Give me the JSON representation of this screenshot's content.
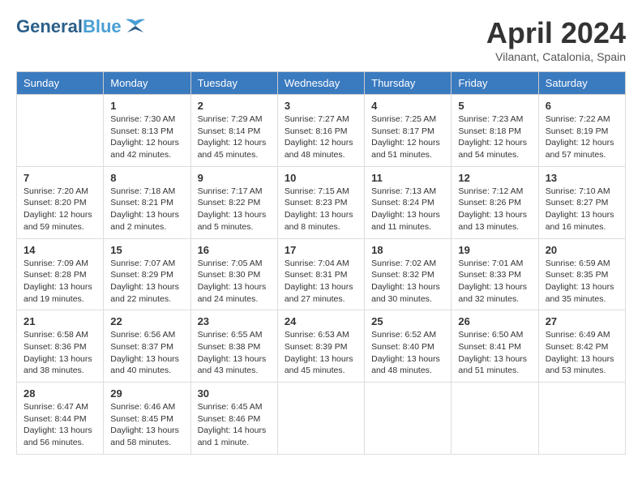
{
  "header": {
    "logo_general": "General",
    "logo_blue": "Blue",
    "month_title": "April 2024",
    "location": "Vilanant, Catalonia, Spain"
  },
  "days_of_week": [
    "Sunday",
    "Monday",
    "Tuesday",
    "Wednesday",
    "Thursday",
    "Friday",
    "Saturday"
  ],
  "weeks": [
    [
      {
        "day": "",
        "info": ""
      },
      {
        "day": "1",
        "info": "Sunrise: 7:30 AM\nSunset: 8:13 PM\nDaylight: 12 hours\nand 42 minutes."
      },
      {
        "day": "2",
        "info": "Sunrise: 7:29 AM\nSunset: 8:14 PM\nDaylight: 12 hours\nand 45 minutes."
      },
      {
        "day": "3",
        "info": "Sunrise: 7:27 AM\nSunset: 8:16 PM\nDaylight: 12 hours\nand 48 minutes."
      },
      {
        "day": "4",
        "info": "Sunrise: 7:25 AM\nSunset: 8:17 PM\nDaylight: 12 hours\nand 51 minutes."
      },
      {
        "day": "5",
        "info": "Sunrise: 7:23 AM\nSunset: 8:18 PM\nDaylight: 12 hours\nand 54 minutes."
      },
      {
        "day": "6",
        "info": "Sunrise: 7:22 AM\nSunset: 8:19 PM\nDaylight: 12 hours\nand 57 minutes."
      }
    ],
    [
      {
        "day": "7",
        "info": "Sunrise: 7:20 AM\nSunset: 8:20 PM\nDaylight: 12 hours\nand 59 minutes."
      },
      {
        "day": "8",
        "info": "Sunrise: 7:18 AM\nSunset: 8:21 PM\nDaylight: 13 hours\nand 2 minutes."
      },
      {
        "day": "9",
        "info": "Sunrise: 7:17 AM\nSunset: 8:22 PM\nDaylight: 13 hours\nand 5 minutes."
      },
      {
        "day": "10",
        "info": "Sunrise: 7:15 AM\nSunset: 8:23 PM\nDaylight: 13 hours\nand 8 minutes."
      },
      {
        "day": "11",
        "info": "Sunrise: 7:13 AM\nSunset: 8:24 PM\nDaylight: 13 hours\nand 11 minutes."
      },
      {
        "day": "12",
        "info": "Sunrise: 7:12 AM\nSunset: 8:26 PM\nDaylight: 13 hours\nand 13 minutes."
      },
      {
        "day": "13",
        "info": "Sunrise: 7:10 AM\nSunset: 8:27 PM\nDaylight: 13 hours\nand 16 minutes."
      }
    ],
    [
      {
        "day": "14",
        "info": "Sunrise: 7:09 AM\nSunset: 8:28 PM\nDaylight: 13 hours\nand 19 minutes."
      },
      {
        "day": "15",
        "info": "Sunrise: 7:07 AM\nSunset: 8:29 PM\nDaylight: 13 hours\nand 22 minutes."
      },
      {
        "day": "16",
        "info": "Sunrise: 7:05 AM\nSunset: 8:30 PM\nDaylight: 13 hours\nand 24 minutes."
      },
      {
        "day": "17",
        "info": "Sunrise: 7:04 AM\nSunset: 8:31 PM\nDaylight: 13 hours\nand 27 minutes."
      },
      {
        "day": "18",
        "info": "Sunrise: 7:02 AM\nSunset: 8:32 PM\nDaylight: 13 hours\nand 30 minutes."
      },
      {
        "day": "19",
        "info": "Sunrise: 7:01 AM\nSunset: 8:33 PM\nDaylight: 13 hours\nand 32 minutes."
      },
      {
        "day": "20",
        "info": "Sunrise: 6:59 AM\nSunset: 8:35 PM\nDaylight: 13 hours\nand 35 minutes."
      }
    ],
    [
      {
        "day": "21",
        "info": "Sunrise: 6:58 AM\nSunset: 8:36 PM\nDaylight: 13 hours\nand 38 minutes."
      },
      {
        "day": "22",
        "info": "Sunrise: 6:56 AM\nSunset: 8:37 PM\nDaylight: 13 hours\nand 40 minutes."
      },
      {
        "day": "23",
        "info": "Sunrise: 6:55 AM\nSunset: 8:38 PM\nDaylight: 13 hours\nand 43 minutes."
      },
      {
        "day": "24",
        "info": "Sunrise: 6:53 AM\nSunset: 8:39 PM\nDaylight: 13 hours\nand 45 minutes."
      },
      {
        "day": "25",
        "info": "Sunrise: 6:52 AM\nSunset: 8:40 PM\nDaylight: 13 hours\nand 48 minutes."
      },
      {
        "day": "26",
        "info": "Sunrise: 6:50 AM\nSunset: 8:41 PM\nDaylight: 13 hours\nand 51 minutes."
      },
      {
        "day": "27",
        "info": "Sunrise: 6:49 AM\nSunset: 8:42 PM\nDaylight: 13 hours\nand 53 minutes."
      }
    ],
    [
      {
        "day": "28",
        "info": "Sunrise: 6:47 AM\nSunset: 8:44 PM\nDaylight: 13 hours\nand 56 minutes."
      },
      {
        "day": "29",
        "info": "Sunrise: 6:46 AM\nSunset: 8:45 PM\nDaylight: 13 hours\nand 58 minutes."
      },
      {
        "day": "30",
        "info": "Sunrise: 6:45 AM\nSunset: 8:46 PM\nDaylight: 14 hours\nand 1 minute."
      },
      {
        "day": "",
        "info": ""
      },
      {
        "day": "",
        "info": ""
      },
      {
        "day": "",
        "info": ""
      },
      {
        "day": "",
        "info": ""
      }
    ]
  ]
}
